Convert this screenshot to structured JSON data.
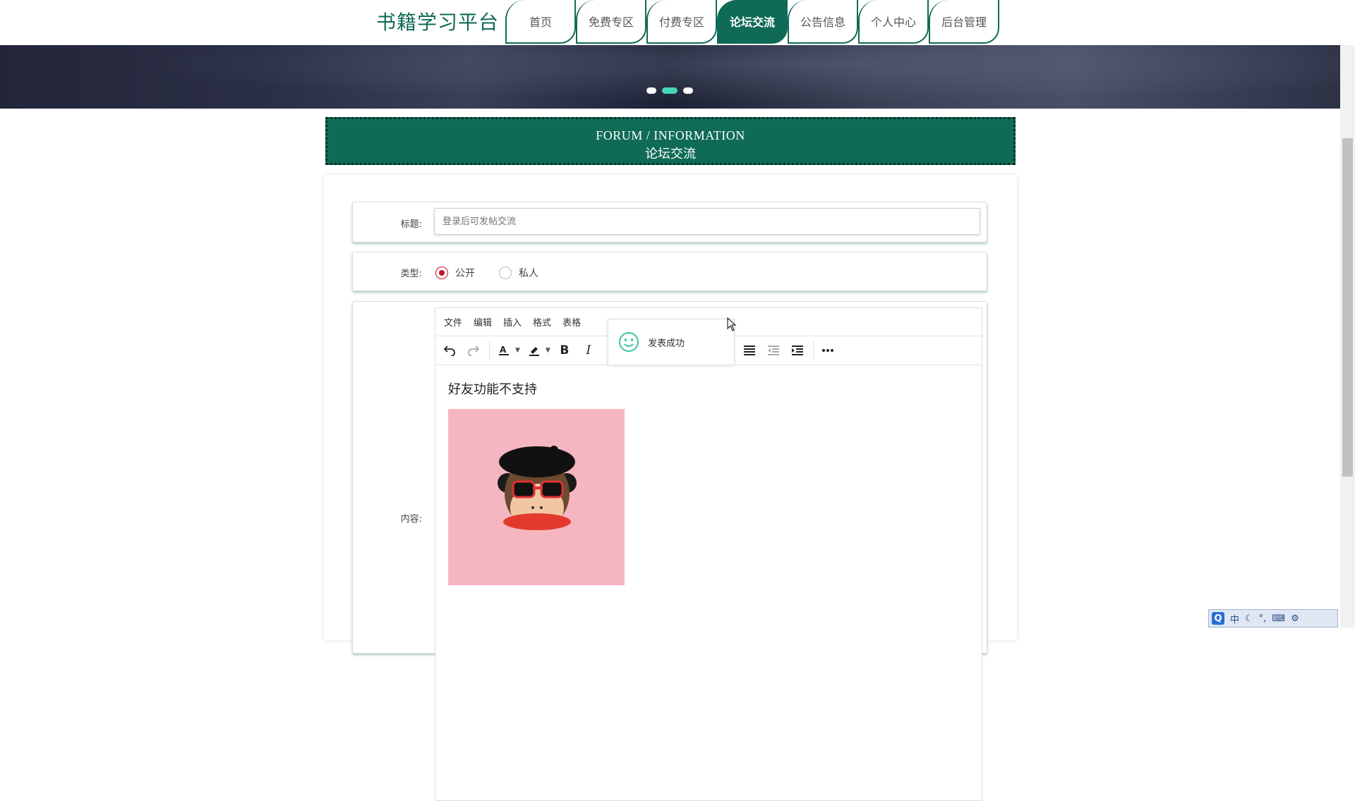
{
  "header": {
    "logo": "书籍学习平台",
    "nav": [
      {
        "label": "首页",
        "active": false
      },
      {
        "label": "免费专区",
        "active": false
      },
      {
        "label": "付费专区",
        "active": false
      },
      {
        "label": "论坛交流",
        "active": true
      },
      {
        "label": "公告信息",
        "active": false
      },
      {
        "label": "个人中心",
        "active": false
      },
      {
        "label": "后台管理",
        "active": false
      }
    ]
  },
  "carousel": {
    "slide_count": 3,
    "active_slide": 2
  },
  "section": {
    "title_en": "FORUM / INFORMATION",
    "title_cn": "论坛交流"
  },
  "form": {
    "title_label": "标题:",
    "title_placeholder": "登录后可发帖交流",
    "type_label": "类型:",
    "type_options": [
      {
        "label": "公开",
        "checked": true
      },
      {
        "label": "私人",
        "checked": false
      }
    ],
    "content_label": "内容:"
  },
  "editor": {
    "menus": [
      "文件",
      "编辑",
      "插入",
      "格式",
      "表格"
    ],
    "body_text": "好友功能不支持"
  },
  "toast": {
    "message": "发表成功"
  },
  "ime": {
    "mode": "中"
  },
  "colors": {
    "brand": "#0f6b55",
    "accent": "#46d6b4",
    "radio": "#c8102e"
  }
}
